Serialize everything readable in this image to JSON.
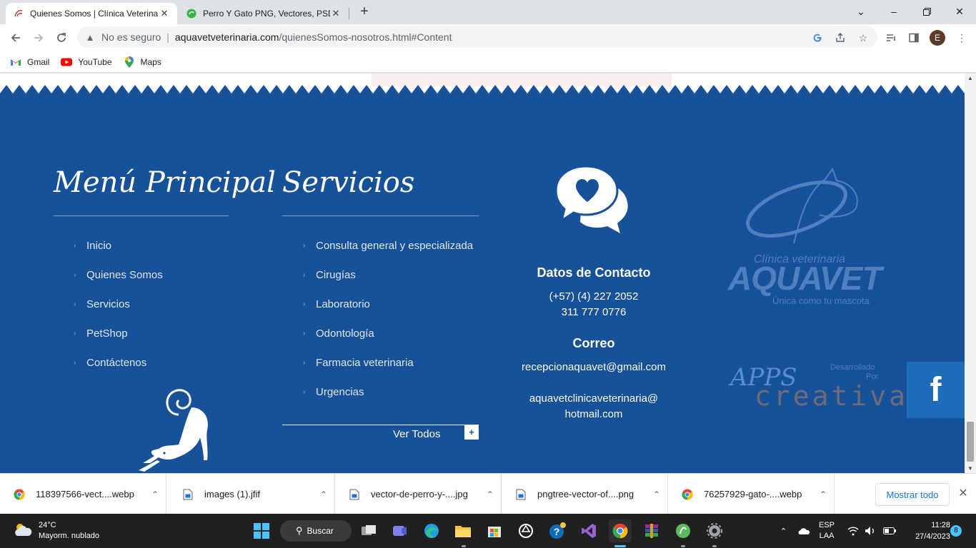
{
  "browser": {
    "tabs": [
      {
        "title": "Quienes Somos | Clínica Veterina",
        "favicon": "aquavet-favicon",
        "active": true
      },
      {
        "title": "Perro Y Gato PNG, Vectores, PSD,",
        "favicon": "pngtree-favicon",
        "active": false
      }
    ],
    "security_label": "No es seguro",
    "url_domain": "aquavetveterinaria.com",
    "url_path": "/quienesSomos-nosotros.html#Content",
    "profile_initial": "E",
    "bookmarks": [
      "Gmail",
      "YouTube",
      "Maps"
    ]
  },
  "footer": {
    "menu_title": "Menú Principal",
    "menu_items": [
      "Inicio",
      "Quienes Somos",
      "Servicios",
      "PetShop",
      "Contáctenos"
    ],
    "services_title": "Servicios",
    "services_items": [
      "Consulta general y especializada",
      "Cirugías",
      "Laboratorio",
      "Odontología",
      "Farmacia veterinaria",
      "Urgencias"
    ],
    "ver_todos": "Ver Todos",
    "contact_heading": "Datos de Contacto",
    "phone1": "(+57) (4) 227 2052",
    "phone2": "311 777 0776",
    "email_heading": "Correo",
    "email1": "recepcionaquavet@gmail.com",
    "email2_line1": "aquavetclinicaveterinaria@",
    "email2_line2": "hotmail.com",
    "logo_tagline_top": "Clínica veterinaria",
    "logo_name": "AQUAVET",
    "logo_tagline_bottom": "Única como tu mascota",
    "dev_label_1": "Desarrollado",
    "dev_label_2": "Por",
    "dev_logo_1": "APPS",
    "dev_logo_2": "creativa",
    "facebook_glyph": "f"
  },
  "downloads": {
    "items": [
      {
        "name": "118397566-vect....webp",
        "icon": "chrome-file-icon"
      },
      {
        "name": "images (1).jfif",
        "icon": "image-file-icon"
      },
      {
        "name": "vector-de-perro-y-....jpg",
        "icon": "image-file-icon"
      },
      {
        "name": "pngtree-vector-of....png",
        "icon": "image-file-icon"
      },
      {
        "name": "76257929-gato-....webp",
        "icon": "chrome-file-icon"
      }
    ],
    "show_all": "Mostrar todo"
  },
  "taskbar": {
    "temperature": "24°C",
    "weather_desc": "Mayorm. nublado",
    "search_label": "Buscar",
    "lang_1": "ESP",
    "lang_2": "LAA",
    "time": "11:28",
    "date": "27/4/2023",
    "notification_count": "8"
  },
  "colors": {
    "footer_bg": "#16519a",
    "facebook_bg": "#1e6bb8",
    "accent_blue": "#1a73e8",
    "taskbar_bg": "#202020"
  }
}
